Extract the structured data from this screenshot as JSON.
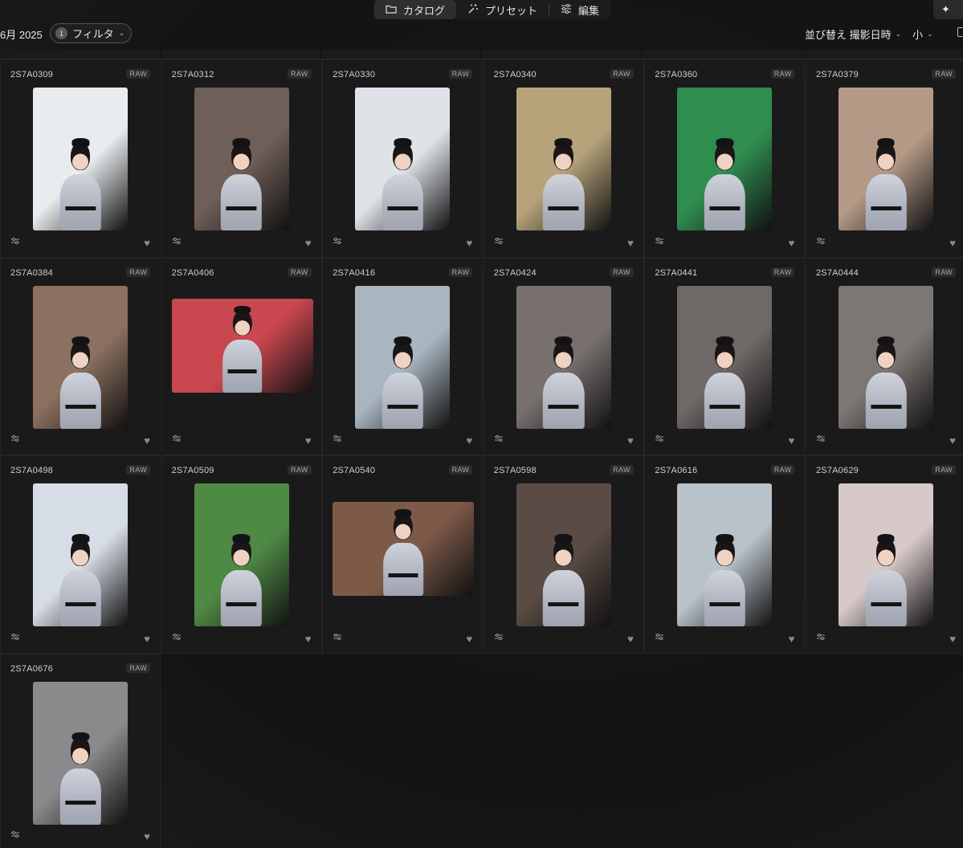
{
  "modes": [
    {
      "label": "カタログ",
      "icon": "folder-icon",
      "active": true
    },
    {
      "label": "プリセット",
      "icon": "magic-wand-icon",
      "active": false
    },
    {
      "label": "編集",
      "icon": "sliders-icon",
      "active": false
    }
  ],
  "ai_button_label": "✦ ",
  "toolbar": {
    "date": "6月 2025",
    "filter_count": "1",
    "filter_label": "フィルタ",
    "sort_label": "並び替え 撮影日時",
    "size_label": "小"
  },
  "photos": [
    {
      "name": "2S7A0309",
      "badge": "RAW",
      "orientation": "portrait",
      "bg": "#e9ecef"
    },
    {
      "name": "2S7A0312",
      "badge": "RAW",
      "orientation": "portrait",
      "bg": "#6e5f58"
    },
    {
      "name": "2S7A0330",
      "badge": "RAW",
      "orientation": "portrait",
      "bg": "#dfe3e8"
    },
    {
      "name": "2S7A0340",
      "badge": "RAW",
      "orientation": "portrait",
      "bg": "#b6a37a"
    },
    {
      "name": "2S7A0360",
      "badge": "RAW",
      "orientation": "portrait",
      "bg": "#2f8d4f"
    },
    {
      "name": "2S7A0379",
      "badge": "RAW",
      "orientation": "portrait",
      "bg": "#b49a86"
    },
    {
      "name": "2S7A0384",
      "badge": "RAW",
      "orientation": "portrait",
      "bg": "#8c7060"
    },
    {
      "name": "2S7A0406",
      "badge": "RAW",
      "orientation": "landscape",
      "bg": "#c9474f"
    },
    {
      "name": "2S7A0416",
      "badge": "RAW",
      "orientation": "portrait",
      "bg": "#a9b6c0"
    },
    {
      "name": "2S7A0424",
      "badge": "RAW",
      "orientation": "portrait",
      "bg": "#77706e"
    },
    {
      "name": "2S7A0441",
      "badge": "RAW",
      "orientation": "portrait",
      "bg": "#6e6866"
    },
    {
      "name": "2S7A0444",
      "badge": "RAW",
      "orientation": "portrait",
      "bg": "#7d7774"
    },
    {
      "name": "2S7A0498",
      "badge": "RAW",
      "orientation": "portrait",
      "bg": "#d7dde6"
    },
    {
      "name": "2S7A0509",
      "badge": "RAW",
      "orientation": "portrait",
      "bg": "#4f8a45"
    },
    {
      "name": "2S7A0540",
      "badge": "RAW",
      "orientation": "landscape",
      "bg": "#7d5a48"
    },
    {
      "name": "2S7A0598",
      "badge": "RAW",
      "orientation": "portrait",
      "bg": "#5a4c45"
    },
    {
      "name": "2S7A0616",
      "badge": "RAW",
      "orientation": "portrait",
      "bg": "#b9c2c9"
    },
    {
      "name": "2S7A0629",
      "badge": "RAW",
      "orientation": "portrait",
      "bg": "#d8c9c9"
    },
    {
      "name": "2S7A0676",
      "badge": "RAW",
      "orientation": "portrait",
      "bg": "#8a8a8c"
    }
  ]
}
